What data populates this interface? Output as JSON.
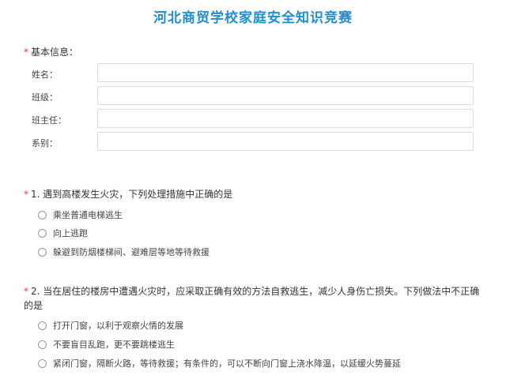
{
  "title": "河北商贸学校家庭安全知识竞赛",
  "basic_info": {
    "title": "基本信息：",
    "fields": [
      {
        "label": "姓名：",
        "value": ""
      },
      {
        "label": "班级：",
        "value": ""
      },
      {
        "label": "班主任：",
        "value": ""
      },
      {
        "label": "系别：",
        "value": ""
      }
    ]
  },
  "questions": [
    {
      "title": "1. 遇到高楼发生火灾，下列处理措施中正确的是",
      "options": [
        "乘坐普通电梯逃生",
        "向上逃跑",
        "躲避到防烟楼梯间、避难层等地等待救援"
      ]
    },
    {
      "title": "2. 当在居住的楼房中遭遇火灾时，应采取正确有效的方法自救逃生，减少人身伤亡损失。下列做法中不正确的是",
      "options": [
        "打开门窗，以利于观察火情的发展",
        "不要盲目乱跑，更不要跳楼逃生",
        "紧闭门窗，隔断火路，等待救援；有条件的，可以不断向门窗上浇水降温，以延缓火势蔓延"
      ]
    }
  ],
  "required_mark": "*",
  "colors": {
    "title": "#1e8ed8",
    "required": "#e5383b",
    "input_border": "#dcdcdc"
  }
}
